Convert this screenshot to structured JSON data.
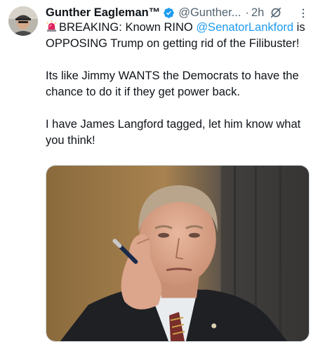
{
  "tweet": {
    "author_name": "Gunther Eagleman™",
    "handle": "@Gunther...",
    "separator": "·",
    "time": "2h",
    "line1_pre": "BREAKING: Known RINO ",
    "mention": "@SenatorLankford",
    "line1_post": " is OPPOSING Trump on getting rid of the Filibuster!",
    "paragraph2": "Its like Jimmy WANTS the Democrats to have the chance to do it if they get power back.",
    "paragraph3": "I have James Langford tagged, let him know what you think!"
  },
  "colors": {
    "accent": "#1d9bf0",
    "secondary_text": "#536471",
    "primary_text": "#0f1419"
  },
  "icons": {
    "verified": "verified-badge-icon",
    "siren": "rotating-light-emoji",
    "grok": "grok-icon",
    "more": "more-dots-icon"
  }
}
